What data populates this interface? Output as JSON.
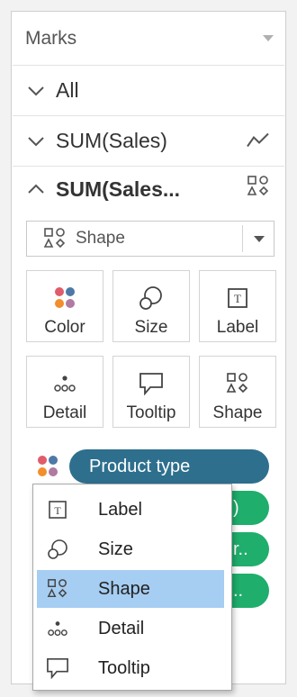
{
  "marks_panel": {
    "title": "Marks",
    "sections": [
      {
        "label": "All",
        "state": "collapsed"
      },
      {
        "label": "SUM(Sales)",
        "state": "collapsed",
        "icon": "line-chart-icon"
      },
      {
        "label": "SUM(Sales...",
        "state": "expanded",
        "icon": "shape-icon"
      }
    ],
    "mark_type": {
      "label": "Shape",
      "icon": "shape-icon"
    },
    "cards": [
      {
        "label": "Color",
        "icon": "color-icon"
      },
      {
        "label": "Size",
        "icon": "size-icon"
      },
      {
        "label": "Label",
        "icon": "label-icon"
      },
      {
        "label": "Detail",
        "icon": "detail-icon"
      },
      {
        "label": "Tooltip",
        "icon": "tooltip-icon"
      },
      {
        "label": "Shape",
        "icon": "shape-icon"
      }
    ],
    "pills": [
      {
        "label": "Product type",
        "color": "#2e6f8e"
      },
      {
        "label": ")",
        "color": "#1fae6c"
      },
      {
        "label": "r..",
        "color": "#1fae6c"
      },
      {
        "label": "..",
        "color": "#1fae6c"
      }
    ]
  },
  "context_menu": {
    "items": [
      {
        "label": "Label",
        "icon": "label-icon",
        "selected": false
      },
      {
        "label": "Size",
        "icon": "size-icon",
        "selected": false
      },
      {
        "label": "Shape",
        "icon": "shape-icon",
        "selected": true
      },
      {
        "label": "Detail",
        "icon": "detail-icon",
        "selected": false
      },
      {
        "label": "Tooltip",
        "icon": "tooltip-icon",
        "selected": false
      }
    ]
  },
  "colors": {
    "pill_dimension": "#2e6f8e",
    "pill_measure": "#1fae6c",
    "menu_highlight": "#a6cdf2"
  }
}
